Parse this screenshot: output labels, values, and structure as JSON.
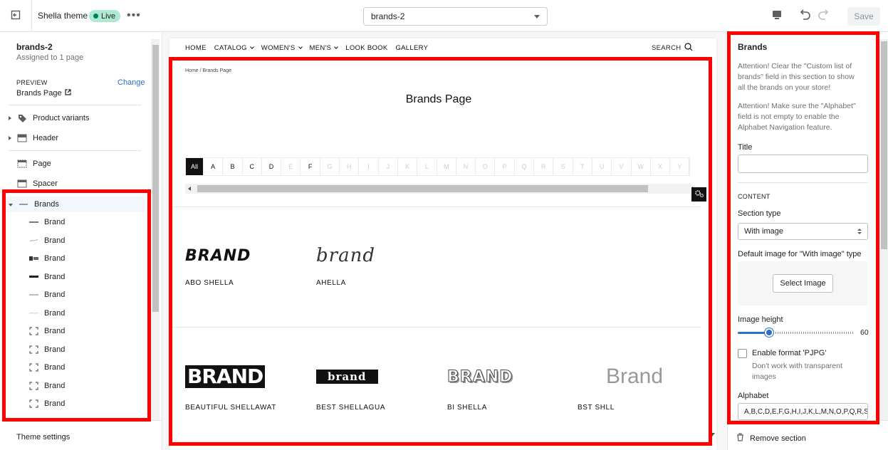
{
  "topbar": {
    "theme_name": "Shella theme",
    "live_label": "Live",
    "more_label": "•••",
    "template_value": "brands-2",
    "save_label": "Save"
  },
  "left": {
    "template_name": "brands-2",
    "assigned": "Assigned to 1 page",
    "preview_label": "PREVIEW",
    "preview_value": "Brands Page",
    "change_label": "Change",
    "tree": {
      "product_variants": "Product variants",
      "header": "Header",
      "page": "Page",
      "spacer": "Spacer",
      "brands": "Brands"
    },
    "brand_children": [
      "Brand",
      "Brand",
      "Brand",
      "Brand",
      "Brand",
      "Brand",
      "Brand",
      "Brand",
      "Brand",
      "Brand",
      "Brand"
    ],
    "theme_settings": "Theme settings"
  },
  "store": {
    "nav": [
      "HOME",
      "CATALOG",
      "WOMEN'S",
      "MEN'S",
      "LOOK BOOK",
      "GALLERY"
    ],
    "search": "SEARCH",
    "breadcrumb": "Home  /  Brands Page",
    "page_title": "Brands Page",
    "alphabet": [
      "All",
      "A",
      "B",
      "C",
      "D",
      "E",
      "F",
      "G",
      "H",
      "I",
      "J",
      "K",
      "L",
      "M",
      "N",
      "O",
      "P",
      "Q",
      "R",
      "S",
      "T",
      "U",
      "V",
      "W",
      "X",
      "Y"
    ],
    "brands_row1": [
      {
        "name": "ABO SHELLA",
        "logo": "BRAND"
      },
      {
        "name": "AHELLA",
        "logo": "brand"
      }
    ],
    "brands_row2": [
      {
        "name": "BEAUTIFUL SHELLAWAT",
        "logo": "BRAND"
      },
      {
        "name": "BEST SHELLAGUA",
        "logo": "brand"
      },
      {
        "name": "BI SHELLA",
        "logo": "BRAND"
      },
      {
        "name": "BST SHLL",
        "logo": "Brand"
      }
    ]
  },
  "right": {
    "title": "Brands",
    "note1": "Attention! Clear the \"Custom list of brands\" field in this section to show all the brands on your store!",
    "note2": "Attention! Make sure the \"Alphabet\" field is not empty to enable the Alphabet Navigation feature.",
    "title_label": "Title",
    "content_label": "CONTENT",
    "section_type_label": "Section type",
    "section_type_value": "With image",
    "default_image_label": "Default image for \"With image\" type",
    "select_image": "Select Image",
    "image_height_label": "Image height",
    "image_height_value": "60",
    "image_height_fraction": 0.27,
    "pjpg_label": "Enable format 'PJPG'",
    "pjpg_help": "Don't work with transparent images",
    "alphabet_label": "Alphabet",
    "alphabet_value": "A,B,C,D,E,F,G,H,I,J,K,L,M,N,O,P,Q,R,S,",
    "remove_section": "Remove section"
  }
}
